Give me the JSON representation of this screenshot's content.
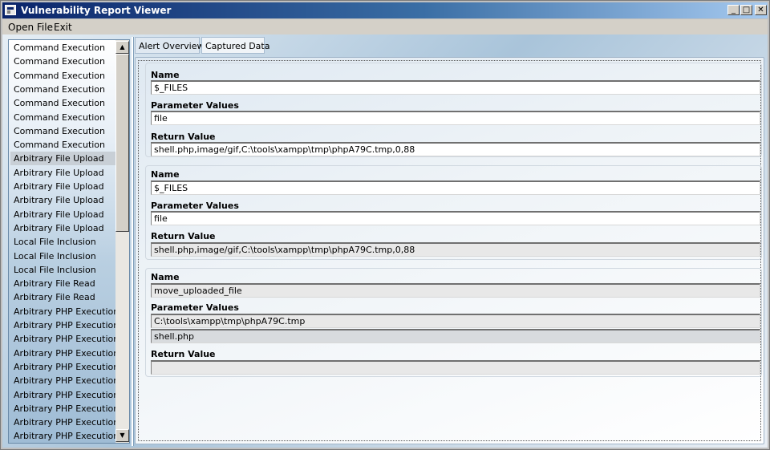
{
  "window": {
    "title": "Vulnerability Report Viewer",
    "buttons": {
      "minimize": "_",
      "maximize": "□",
      "close": "✕"
    }
  },
  "menu": {
    "items": [
      {
        "label": "Open File"
      },
      {
        "label": "Exit"
      }
    ]
  },
  "sidebar": {
    "selected_index": 8,
    "items": [
      {
        "label": "Command Execution"
      },
      {
        "label": "Command Execution"
      },
      {
        "label": "Command Execution"
      },
      {
        "label": "Command Execution"
      },
      {
        "label": "Command Execution"
      },
      {
        "label": "Command Execution"
      },
      {
        "label": "Command Execution"
      },
      {
        "label": "Command Execution"
      },
      {
        "label": "Arbitrary File Upload"
      },
      {
        "label": "Arbitrary File Upload"
      },
      {
        "label": "Arbitrary File Upload"
      },
      {
        "label": "Arbitrary File Upload"
      },
      {
        "label": "Arbitrary File Upload"
      },
      {
        "label": "Arbitrary File Upload"
      },
      {
        "label": "Local File Inclusion"
      },
      {
        "label": "Local File Inclusion"
      },
      {
        "label": "Local File Inclusion"
      },
      {
        "label": "Arbitrary File Read"
      },
      {
        "label": "Arbitrary File Read"
      },
      {
        "label": "Arbitrary PHP Execution"
      },
      {
        "label": "Arbitrary PHP Execution"
      },
      {
        "label": "Arbitrary PHP Execution"
      },
      {
        "label": "Arbitrary PHP Execution"
      },
      {
        "label": "Arbitrary PHP Execution"
      },
      {
        "label": "Arbitrary PHP Execution"
      },
      {
        "label": "Arbitrary PHP Execution"
      },
      {
        "label": "Arbitrary PHP Execution"
      },
      {
        "label": "Arbitrary PHP Execution"
      },
      {
        "label": "Arbitrary PHP Execution"
      }
    ],
    "scroll_up_icon": "▲",
    "scroll_down_icon": "▼"
  },
  "tabs": [
    {
      "label": "Alert Overview",
      "active": false
    },
    {
      "label": "Captured Data",
      "active": true
    }
  ],
  "labels": {
    "name": "Name",
    "parameter_values": "Parameter Values",
    "return_value": "Return Value"
  },
  "captured": [
    {
      "name": "$_FILES",
      "parameter_values": [
        "file"
      ],
      "return_value": "shell.php,image/gif,C:\\tools\\xampp\\tmp\\phpA79C.tmp,0,88"
    },
    {
      "name": "$_FILES",
      "parameter_values": [
        "file"
      ],
      "return_value": "shell.php,image/gif,C:\\tools\\xampp\\tmp\\phpA79C.tmp,0,88"
    },
    {
      "name": "move_uploaded_file",
      "parameter_values": [
        "C:\\tools\\xampp\\tmp\\phpA79C.tmp",
        "shell.php"
      ],
      "return_value": ""
    }
  ]
}
